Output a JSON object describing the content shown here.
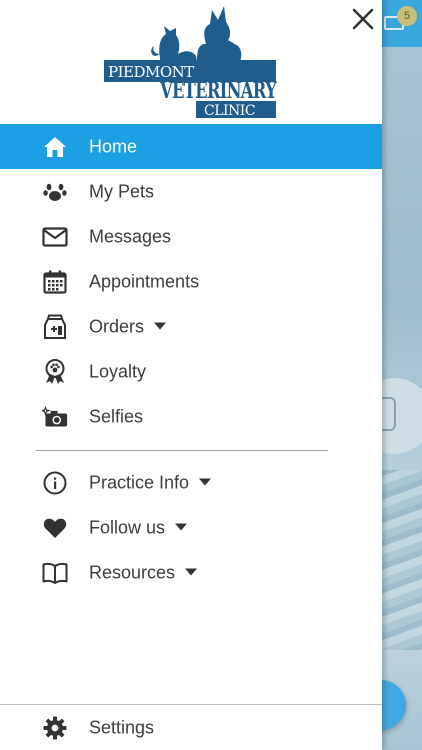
{
  "background": {
    "notification_badge": "5"
  },
  "drawer": {
    "logo": {
      "line1": "PIEDMONT",
      "line2": "VETERINARY",
      "line3": "CLINIC"
    },
    "menu": [
      {
        "label": "Home",
        "icon": "home-icon",
        "active": true
      },
      {
        "label": "My Pets",
        "icon": "paw-icon"
      },
      {
        "label": "Messages",
        "icon": "envelope-icon"
      },
      {
        "label": "Appointments",
        "icon": "calendar-icon"
      },
      {
        "label": "Orders",
        "icon": "food-bag-icon",
        "has_dropdown": true
      },
      {
        "label": "Loyalty",
        "icon": "award-ribbon-icon"
      },
      {
        "label": "Selfies",
        "icon": "camera-sparkle-icon"
      }
    ],
    "secondary_menu": [
      {
        "label": "Practice Info",
        "icon": "info-icon",
        "has_dropdown": true
      },
      {
        "label": "Follow us",
        "icon": "heart-icon",
        "has_dropdown": true
      },
      {
        "label": "Resources",
        "icon": "book-icon",
        "has_dropdown": true
      }
    ],
    "settings_label": "Settings"
  },
  "colors": {
    "accent": "#1aa0e3",
    "logo_blue": "#1f5d8f",
    "icon": "#333333",
    "text": "#3d3d3d"
  }
}
